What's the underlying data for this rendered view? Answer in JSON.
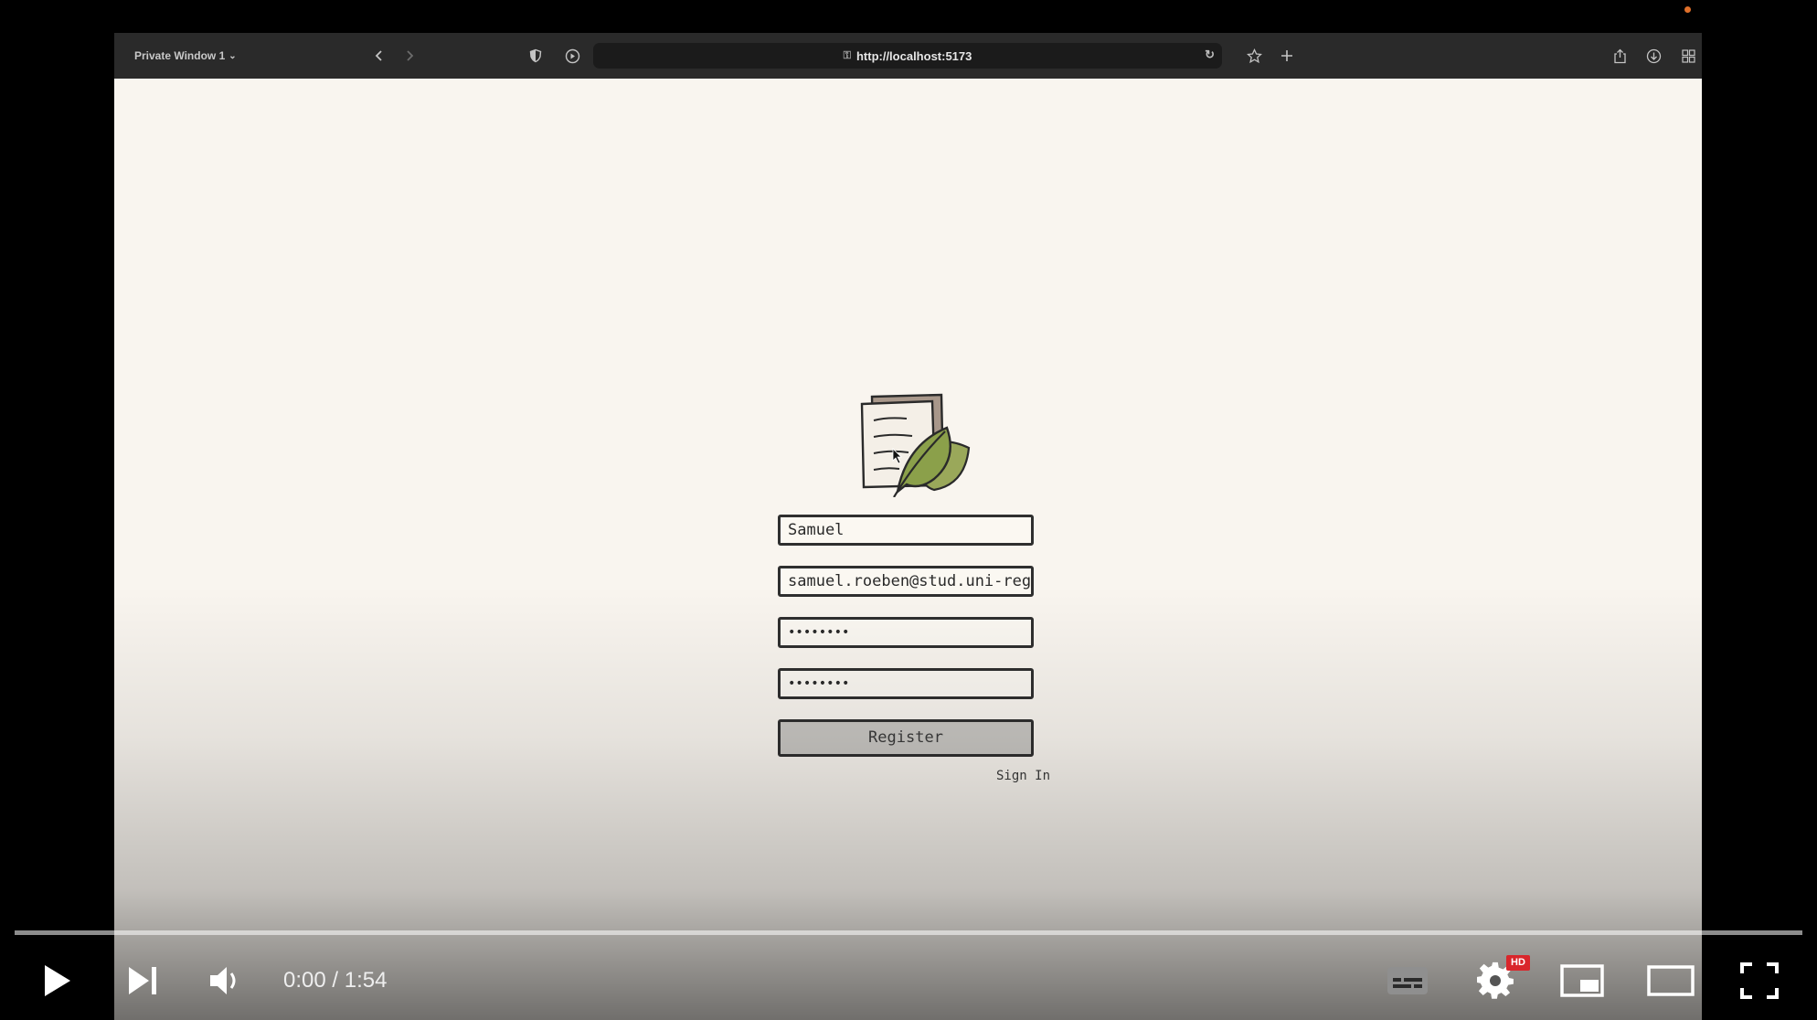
{
  "browser": {
    "window_label": "Private Window 1",
    "url": "http://localhost:5173",
    "icons": [
      "chevron-down-icon",
      "back-icon",
      "forward-icon",
      "shield-icon",
      "tracking-icon",
      "lock-icon",
      "reload-icon",
      "bookmark-star-icon",
      "new-tab-icon",
      "share-icon",
      "download-icon",
      "tabs-grid-icon"
    ]
  },
  "form": {
    "name_value": "Samuel",
    "email_value": "samuel.roeben@stud.uni-reger",
    "password_value": "••••••••",
    "confirm_password_value": "••••••••",
    "register_label": "Register",
    "signin_label": "Sign In"
  },
  "player": {
    "time_display": "0:00 / 1:54",
    "hd_badge": "HD",
    "progress_fraction": 0.0,
    "icons": [
      "play-icon",
      "next-icon",
      "volume-icon",
      "subtitles-icon",
      "settings-icon",
      "miniplayer-icon",
      "theater-icon",
      "fullscreen-icon"
    ]
  },
  "colors": {
    "page_bg": "#f9f5ef",
    "leaf_green": "#8ba04a",
    "hd_red": "#d9262b",
    "rec_dot": "#e0702a"
  }
}
